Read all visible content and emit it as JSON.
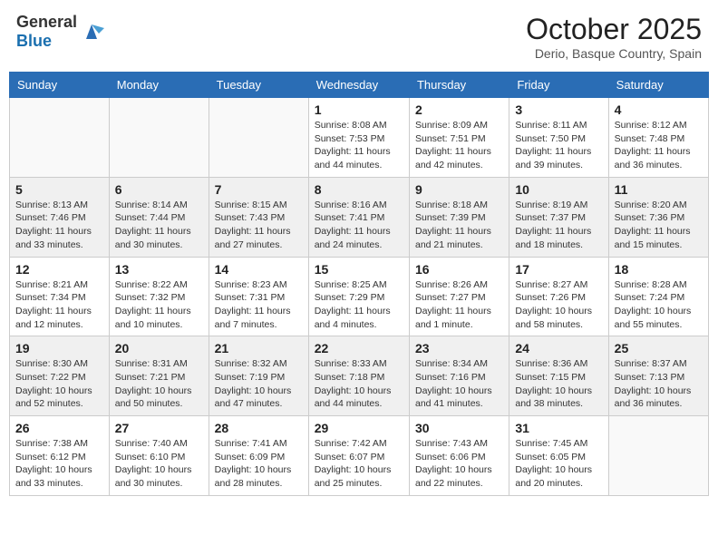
{
  "header": {
    "logo_general": "General",
    "logo_blue": "Blue",
    "month": "October 2025",
    "location": "Derio, Basque Country, Spain"
  },
  "days_of_week": [
    "Sunday",
    "Monday",
    "Tuesday",
    "Wednesday",
    "Thursday",
    "Friday",
    "Saturday"
  ],
  "weeks": [
    {
      "shaded": false,
      "days": [
        {
          "num": "",
          "text": ""
        },
        {
          "num": "",
          "text": ""
        },
        {
          "num": "",
          "text": ""
        },
        {
          "num": "1",
          "text": "Sunrise: 8:08 AM\nSunset: 7:53 PM\nDaylight: 11 hours and 44 minutes."
        },
        {
          "num": "2",
          "text": "Sunrise: 8:09 AM\nSunset: 7:51 PM\nDaylight: 11 hours and 42 minutes."
        },
        {
          "num": "3",
          "text": "Sunrise: 8:11 AM\nSunset: 7:50 PM\nDaylight: 11 hours and 39 minutes."
        },
        {
          "num": "4",
          "text": "Sunrise: 8:12 AM\nSunset: 7:48 PM\nDaylight: 11 hours and 36 minutes."
        }
      ]
    },
    {
      "shaded": true,
      "days": [
        {
          "num": "5",
          "text": "Sunrise: 8:13 AM\nSunset: 7:46 PM\nDaylight: 11 hours and 33 minutes."
        },
        {
          "num": "6",
          "text": "Sunrise: 8:14 AM\nSunset: 7:44 PM\nDaylight: 11 hours and 30 minutes."
        },
        {
          "num": "7",
          "text": "Sunrise: 8:15 AM\nSunset: 7:43 PM\nDaylight: 11 hours and 27 minutes."
        },
        {
          "num": "8",
          "text": "Sunrise: 8:16 AM\nSunset: 7:41 PM\nDaylight: 11 hours and 24 minutes."
        },
        {
          "num": "9",
          "text": "Sunrise: 8:18 AM\nSunset: 7:39 PM\nDaylight: 11 hours and 21 minutes."
        },
        {
          "num": "10",
          "text": "Sunrise: 8:19 AM\nSunset: 7:37 PM\nDaylight: 11 hours and 18 minutes."
        },
        {
          "num": "11",
          "text": "Sunrise: 8:20 AM\nSunset: 7:36 PM\nDaylight: 11 hours and 15 minutes."
        }
      ]
    },
    {
      "shaded": false,
      "days": [
        {
          "num": "12",
          "text": "Sunrise: 8:21 AM\nSunset: 7:34 PM\nDaylight: 11 hours and 12 minutes."
        },
        {
          "num": "13",
          "text": "Sunrise: 8:22 AM\nSunset: 7:32 PM\nDaylight: 11 hours and 10 minutes."
        },
        {
          "num": "14",
          "text": "Sunrise: 8:23 AM\nSunset: 7:31 PM\nDaylight: 11 hours and 7 minutes."
        },
        {
          "num": "15",
          "text": "Sunrise: 8:25 AM\nSunset: 7:29 PM\nDaylight: 11 hours and 4 minutes."
        },
        {
          "num": "16",
          "text": "Sunrise: 8:26 AM\nSunset: 7:27 PM\nDaylight: 11 hours and 1 minute."
        },
        {
          "num": "17",
          "text": "Sunrise: 8:27 AM\nSunset: 7:26 PM\nDaylight: 10 hours and 58 minutes."
        },
        {
          "num": "18",
          "text": "Sunrise: 8:28 AM\nSunset: 7:24 PM\nDaylight: 10 hours and 55 minutes."
        }
      ]
    },
    {
      "shaded": true,
      "days": [
        {
          "num": "19",
          "text": "Sunrise: 8:30 AM\nSunset: 7:22 PM\nDaylight: 10 hours and 52 minutes."
        },
        {
          "num": "20",
          "text": "Sunrise: 8:31 AM\nSunset: 7:21 PM\nDaylight: 10 hours and 50 minutes."
        },
        {
          "num": "21",
          "text": "Sunrise: 8:32 AM\nSunset: 7:19 PM\nDaylight: 10 hours and 47 minutes."
        },
        {
          "num": "22",
          "text": "Sunrise: 8:33 AM\nSunset: 7:18 PM\nDaylight: 10 hours and 44 minutes."
        },
        {
          "num": "23",
          "text": "Sunrise: 8:34 AM\nSunset: 7:16 PM\nDaylight: 10 hours and 41 minutes."
        },
        {
          "num": "24",
          "text": "Sunrise: 8:36 AM\nSunset: 7:15 PM\nDaylight: 10 hours and 38 minutes."
        },
        {
          "num": "25",
          "text": "Sunrise: 8:37 AM\nSunset: 7:13 PM\nDaylight: 10 hours and 36 minutes."
        }
      ]
    },
    {
      "shaded": false,
      "days": [
        {
          "num": "26",
          "text": "Sunrise: 7:38 AM\nSunset: 6:12 PM\nDaylight: 10 hours and 33 minutes."
        },
        {
          "num": "27",
          "text": "Sunrise: 7:40 AM\nSunset: 6:10 PM\nDaylight: 10 hours and 30 minutes."
        },
        {
          "num": "28",
          "text": "Sunrise: 7:41 AM\nSunset: 6:09 PM\nDaylight: 10 hours and 28 minutes."
        },
        {
          "num": "29",
          "text": "Sunrise: 7:42 AM\nSunset: 6:07 PM\nDaylight: 10 hours and 25 minutes."
        },
        {
          "num": "30",
          "text": "Sunrise: 7:43 AM\nSunset: 6:06 PM\nDaylight: 10 hours and 22 minutes."
        },
        {
          "num": "31",
          "text": "Sunrise: 7:45 AM\nSunset: 6:05 PM\nDaylight: 10 hours and 20 minutes."
        },
        {
          "num": "",
          "text": ""
        }
      ]
    }
  ]
}
